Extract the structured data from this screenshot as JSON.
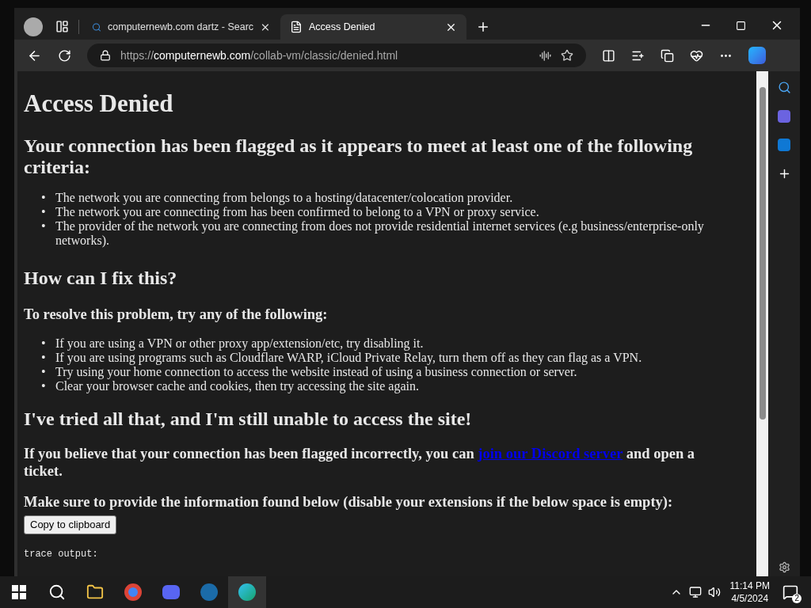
{
  "tabs": [
    {
      "kind": "search",
      "label": "computernewb.com dartz - Searc",
      "selected": false
    },
    {
      "kind": "page",
      "label": "Access Denied",
      "selected": true
    }
  ],
  "address": {
    "scheme": "https://",
    "domain": "computernewb.com",
    "path": "/collab-vm/classic/denied.html"
  },
  "page": {
    "title": "Access Denied",
    "bullet": "•",
    "heading1": "Your connection has been flagged as it appears to meet at least one of the following criteria:",
    "criteria": [
      "The network you are connecting from belongs to a hosting/datacenter/colocation provider.",
      "The network you are connecting from has been confirmed to belong to a VPN or proxy service.",
      "The provider of the network you are connecting from does not provide residential internet services (e.g business/enterprise-only networks)."
    ],
    "heading2": "How can I fix this?",
    "subheading": "To resolve this problem, try any of the following:",
    "fixes": [
      "If you are using a VPN or other proxy app/extension/etc, try disabling it.",
      "If you are using programs such as Cloudflare WARP, iCloud Private Relay, turn them off as they can flag as a VPN.",
      "Try using your home connection to access the website instead of using a business connection or server.",
      "Clear your browser cache and cookies, then try accessing the site again."
    ],
    "heading3": "I've tried all that, and I'm still unable to access the site!",
    "contact_before": "If you believe that your connection has been flagged incorrectly, you can",
    "contact_link": "join our Discord server",
    "contact_after": "and open a ticket.",
    "provide": "Make sure to provide the information found below (disable your extensions if the below space is empty):",
    "copy_button": "Copy to clipboard",
    "trace": "trace output:"
  },
  "clock": {
    "time": "11:14 PM",
    "date": "4/5/2024"
  },
  "notifications": "2"
}
